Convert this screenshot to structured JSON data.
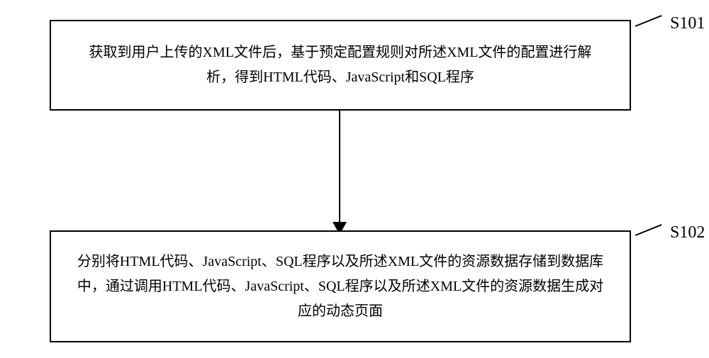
{
  "chart_data": {
    "type": "diagram",
    "title": "",
    "steps": [
      {
        "id": "S101",
        "text": "获取到用户上传的XML文件后，基于预定配置规则对所述XML文件的配置进行解析，得到HTML代码、JavaScript和SQL程序"
      },
      {
        "id": "S102",
        "text": "分别将HTML代码、JavaScript、SQL程序以及所述XML文件的资源数据存储到数据库中，通过调用HTML代码、JavaScript、SQL程序以及所述XML文件的资源数据生成对应的动态页面"
      }
    ],
    "flow": [
      {
        "from": "S101",
        "to": "S102"
      }
    ]
  }
}
